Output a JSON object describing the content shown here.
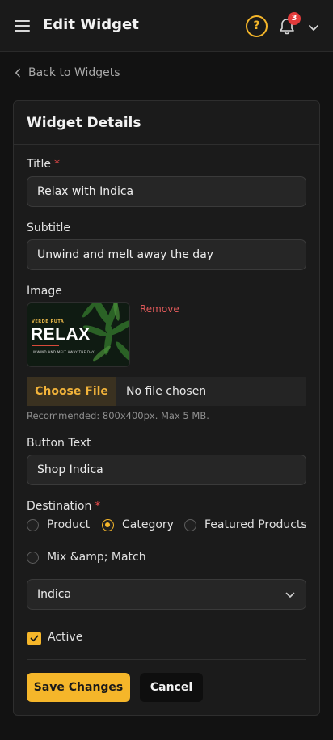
{
  "header": {
    "title": "Edit Widget",
    "help_icon_glyph": "?",
    "notification_count": "3",
    "accent_color": "#f5b62a",
    "badge_color": "#e23b3b"
  },
  "nav": {
    "back_label": "Back to Widgets"
  },
  "form": {
    "card_title": "Widget Details",
    "title": {
      "label": "Title",
      "required": "*",
      "value": "Relax with Indica"
    },
    "subtitle": {
      "label": "Subtitle",
      "value": "Unwind and melt away the day"
    },
    "image": {
      "label": "Image",
      "remove_label": "Remove",
      "thumbnail": {
        "eyebrow": "VERDE RUTA",
        "headline": "RELAX",
        "tagline": "UNWIND AND MELT AWAY THE DAY"
      },
      "file_button": "Choose File",
      "file_status": "No file chosen",
      "hint": "Recommended: 800x400px. Max 5 MB."
    },
    "button_text": {
      "label": "Button Text",
      "value": "Shop Indica"
    },
    "destination": {
      "label": "Destination",
      "required": "*",
      "options": [
        {
          "label": "Product",
          "selected": false
        },
        {
          "label": "Category",
          "selected": true
        },
        {
          "label": "Featured Products",
          "selected": false
        },
        {
          "label": "Mix &amp; Match",
          "selected": false
        }
      ],
      "select_value": "Indica"
    },
    "active": {
      "label": "Active",
      "checked": true
    },
    "actions": {
      "save_label": "Save Changes",
      "cancel_label": "Cancel"
    }
  }
}
